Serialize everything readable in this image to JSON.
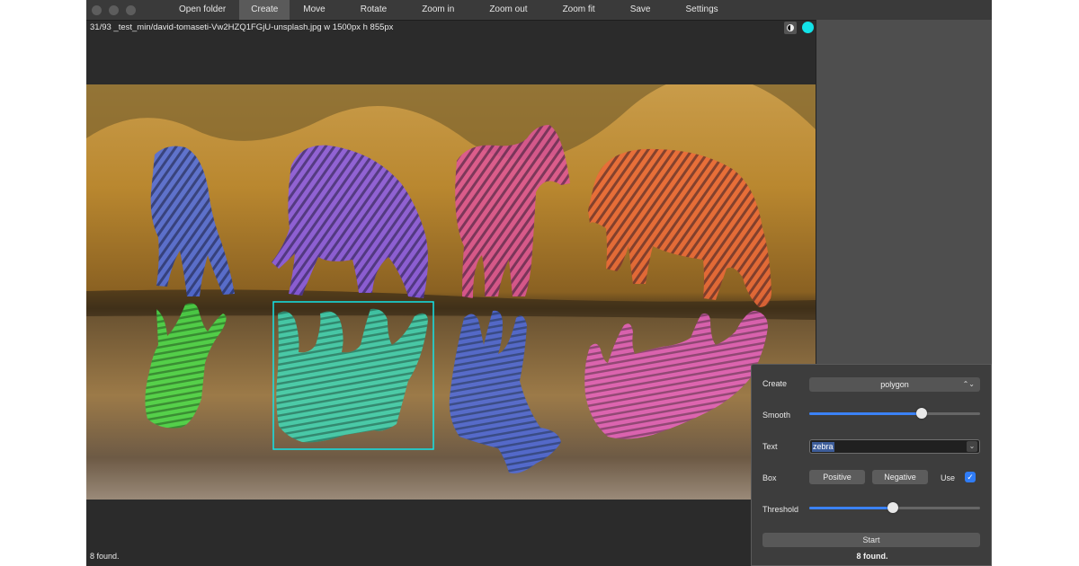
{
  "toolbar": {
    "open_folder": "Open folder",
    "create": "Create",
    "move": "Move",
    "rotate": "Rotate",
    "zoom_in": "Zoom in",
    "zoom_out": "Zoom out",
    "zoom_fit": "Zoom fit",
    "save": "Save",
    "settings": "Settings"
  },
  "image_info": "31/93 _test_min/david-tomaseti-Vw2HZQ1FGjU-unsplash.jpg w 1500px h 855px",
  "status": "8 found.",
  "accent_color": "#12e3e8",
  "annotations": [
    {
      "label": "zebra",
      "color": "#4f6ee6"
    },
    {
      "label": "zebra",
      "color": "#8a5cf0"
    },
    {
      "label": "zebra",
      "color": "#e0559a"
    },
    {
      "label": "zebra",
      "color": "#ef6a3a"
    },
    {
      "label": "zebra",
      "color": "#4be04b"
    },
    {
      "label": "zebra",
      "color": "#3fd9b8",
      "selected": true
    },
    {
      "label": "zebra",
      "color": "#4e6be0"
    },
    {
      "label": "zebra",
      "color": "#ea63c2"
    }
  ],
  "panel": {
    "create_label": "Create",
    "create_value": "polygon",
    "smooth_label": "Smooth",
    "smooth_value": 0.66,
    "text_label": "Text",
    "text_value": "zebra",
    "box_label": "Box",
    "positive_label": "Positive",
    "negative_label": "Negative",
    "use_label": "Use",
    "use_checked": true,
    "threshold_label": "Threshold",
    "threshold_value": 0.49,
    "start_label": "Start",
    "found_text": "8 found."
  }
}
